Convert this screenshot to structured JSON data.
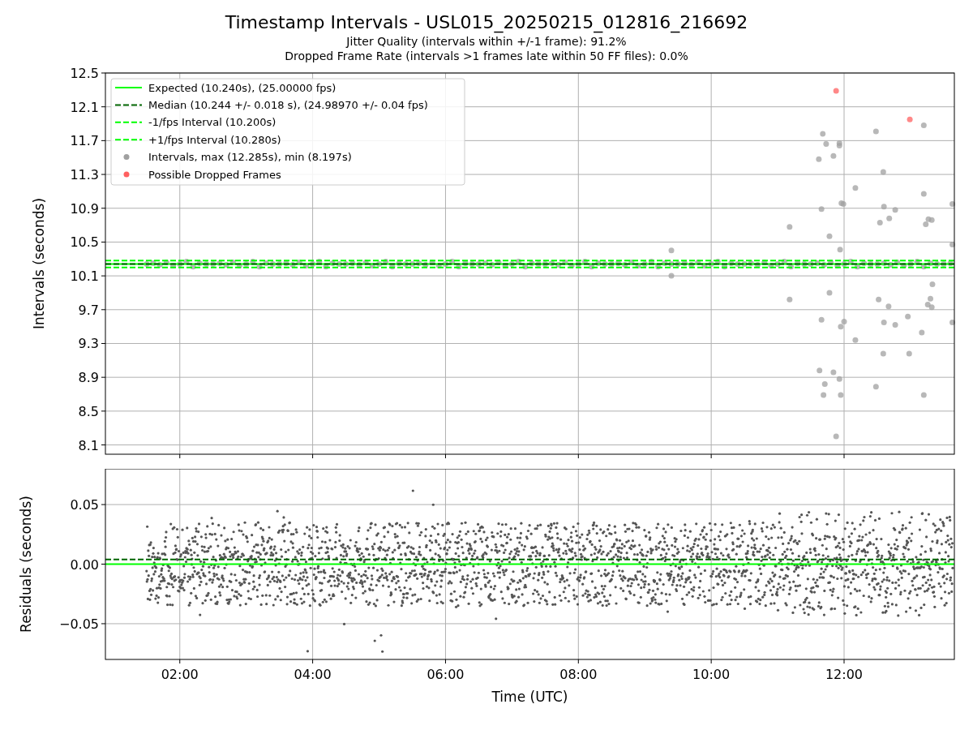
{
  "figure": {
    "title": "Timestamp Intervals - USL015_20250215_012816_216692",
    "subtitles": [
      "Jitter Quality (intervals within +/-1 frame): 91.2%",
      "Dropped Frame Rate (intervals >1 frames late within 50 FF files): 0.0%"
    ]
  },
  "intervals_panel": {
    "chart_data": {
      "type": "scatter",
      "ylabel": "Intervals (seconds)",
      "xlim": [
        0.88,
        13.66
      ],
      "ylim": [
        7.99,
        12.5
      ],
      "grid": true,
      "legend": "upper left",
      "yticks": [
        {
          "value": 8.1,
          "label": "8.1"
        },
        {
          "value": 8.5,
          "label": "8.5"
        },
        {
          "value": 8.9,
          "label": "8.9"
        },
        {
          "value": 9.3,
          "label": "9.3"
        },
        {
          "value": 9.7,
          "label": "9.7"
        },
        {
          "value": 10.1,
          "label": "10.1"
        },
        {
          "value": 10.5,
          "label": "10.5"
        },
        {
          "value": 10.9,
          "label": "10.9"
        },
        {
          "value": 11.3,
          "label": "11.3"
        },
        {
          "value": 11.7,
          "label": "11.7"
        },
        {
          "value": 12.1,
          "label": "12.1"
        },
        {
          "value": 12.5,
          "label": "12.5"
        }
      ],
      "ref_lines": [
        {
          "axis": "y",
          "value": 10.24,
          "label": "Expected (10.240s), (25.00000 fps)",
          "color": "#00ff00",
          "line_style": "solid"
        },
        {
          "axis": "y",
          "value": 10.24,
          "label": "Median (10.244 +/- 0.018 s), (24.98970 +/- 0.04 fps)",
          "color": "#006400",
          "line_style": "dashed"
        },
        {
          "axis": "y",
          "value": 10.2,
          "label": "-1/fps Interval (10.200s)",
          "color": "#00ff00",
          "line_style": "dashed"
        },
        {
          "axis": "y",
          "value": 10.28,
          "label": "+1/fps Interval (10.280s)",
          "color": "#00ff00",
          "line_style": "dashed"
        }
      ],
      "series": [
        {
          "name": "Intervals, max (12.285s), min (8.197s)",
          "color": "#a0a0a0",
          "x": [
            1.5,
            1.6,
            1.7,
            1.8,
            1.9,
            2.0,
            2.1,
            2.2,
            2.3,
            2.4,
            2.5,
            2.6,
            2.7,
            2.8,
            2.9,
            3.0,
            3.1,
            3.2,
            3.3,
            3.4,
            3.5,
            3.6,
            3.7,
            3.8,
            3.9,
            4.0,
            4.1,
            4.2,
            4.3,
            4.4,
            4.5,
            4.6,
            4.7,
            4.8,
            4.9,
            5.0,
            5.1,
            5.2,
            5.3,
            5.4,
            5.5,
            5.6,
            5.7,
            5.8,
            5.9,
            6.0,
            6.1,
            6.2,
            6.3,
            6.4,
            6.5,
            6.6,
            6.7,
            6.8,
            6.9,
            7.0,
            7.1,
            7.2,
            7.3,
            7.4,
            7.5,
            7.6,
            7.7,
            7.8,
            7.9,
            8.0,
            8.1,
            8.2,
            8.3,
            8.4,
            8.5,
            8.6,
            8.7,
            8.8,
            8.9,
            9.0,
            9.1,
            9.2,
            9.3,
            9.4,
            9.5,
            9.6,
            9.7,
            9.8,
            9.9,
            10.0,
            10.1,
            10.2,
            10.3,
            10.4,
            10.5,
            10.6,
            10.7,
            10.8,
            10.9,
            11.0,
            11.1,
            11.2,
            11.3,
            11.4,
            11.5,
            11.6,
            11.7,
            11.8,
            11.9,
            12.0,
            12.1,
            12.2,
            12.3,
            12.4,
            12.5,
            12.6,
            12.7,
            12.8,
            12.9,
            13.0,
            13.1,
            13.2,
            13.3,
            13.4,
            13.5,
            13.6,
            11.68,
            11.73,
            11.62,
            11.84,
            11.93,
            11.93,
            12.48,
            13.2,
            11.18,
            11.66,
            11.78,
            11.96,
            11.99,
            12.17,
            12.59,
            12.6,
            12.68,
            12.77,
            12.54,
            13.2,
            13.27,
            13.32,
            13.23,
            13.63,
            13.63,
            11.94,
            9.4,
            9.4,
            11.18,
            11.78,
            11.66,
            11.95,
            12.0,
            12.17,
            12.52,
            12.6,
            12.67,
            12.77,
            12.96,
            13.17,
            13.3,
            13.26,
            13.32,
            13.33,
            13.63,
            11.63,
            11.71,
            11.69,
            11.84,
            11.93,
            11.95,
            11.88,
            12.48,
            12.59,
            12.98,
            13.2
          ],
          "values": [
            10.24,
            10.25,
            10.23,
            10.26,
            10.22,
            10.24,
            10.27,
            10.21,
            10.25,
            10.24,
            10.24,
            10.25,
            10.23,
            10.26,
            10.22,
            10.24,
            10.27,
            10.21,
            10.25,
            10.24,
            10.24,
            10.25,
            10.23,
            10.26,
            10.22,
            10.24,
            10.27,
            10.21,
            10.25,
            10.24,
            10.24,
            10.25,
            10.23,
            10.26,
            10.22,
            10.24,
            10.27,
            10.21,
            10.25,
            10.24,
            10.24,
            10.25,
            10.23,
            10.26,
            10.22,
            10.24,
            10.27,
            10.21,
            10.25,
            10.24,
            10.24,
            10.25,
            10.23,
            10.26,
            10.22,
            10.24,
            10.27,
            10.21,
            10.25,
            10.24,
            10.24,
            10.25,
            10.23,
            10.26,
            10.22,
            10.24,
            10.27,
            10.21,
            10.25,
            10.24,
            10.24,
            10.25,
            10.23,
            10.26,
            10.22,
            10.24,
            10.27,
            10.21,
            10.25,
            10.24,
            10.24,
            10.25,
            10.23,
            10.26,
            10.22,
            10.24,
            10.27,
            10.21,
            10.25,
            10.24,
            10.24,
            10.25,
            10.23,
            10.26,
            10.22,
            10.24,
            10.27,
            10.21,
            10.25,
            10.24,
            10.24,
            10.25,
            10.23,
            10.26,
            10.22,
            10.24,
            10.27,
            10.21,
            10.25,
            10.24,
            10.24,
            10.25,
            10.23,
            10.26,
            10.22,
            10.24,
            10.27,
            10.21,
            10.25,
            10.24,
            10.24,
            10.25,
            11.78,
            11.66,
            11.48,
            11.52,
            11.64,
            11.67,
            11.81,
            11.88,
            10.68,
            10.89,
            10.57,
            10.96,
            10.95,
            11.14,
            11.33,
            10.92,
            10.78,
            10.88,
            10.73,
            11.07,
            10.77,
            10.76,
            10.71,
            10.95,
            10.47,
            10.41,
            10.4,
            10.1,
            9.82,
            9.9,
            9.58,
            9.5,
            9.56,
            9.34,
            9.82,
            9.55,
            9.74,
            9.52,
            9.62,
            9.43,
            9.83,
            9.76,
            9.73,
            10.0,
            9.55,
            8.98,
            8.82,
            8.69,
            8.96,
            8.88,
            8.69,
            8.2,
            8.79,
            9.18,
            9.18,
            8.69
          ]
        },
        {
          "name": "Possible Dropped Frames",
          "color": "#ff6060",
          "x": [
            11.88,
            12.99
          ],
          "values": [
            12.29,
            11.95
          ]
        }
      ]
    }
  },
  "residuals_panel": {
    "chart_data": {
      "type": "scatter",
      "xlabel": "Time (UTC)",
      "ylabel": "Residuals (seconds)",
      "xlim": [
        0.88,
        13.66
      ],
      "ylim": [
        -0.08,
        0.08
      ],
      "grid": true,
      "xticks": [
        {
          "value": 2,
          "label": "02:00"
        },
        {
          "value": 4,
          "label": "04:00"
        },
        {
          "value": 6,
          "label": "06:00"
        },
        {
          "value": 8,
          "label": "08:00"
        },
        {
          "value": 10,
          "label": "10:00"
        },
        {
          "value": 12,
          "label": "12:00"
        }
      ],
      "yticks": [
        {
          "value": -0.05,
          "label": "−0.05"
        },
        {
          "value": 0,
          "label": "0.00"
        },
        {
          "value": 0.05,
          "label": "0.05"
        }
      ],
      "ref_lines": [
        {
          "axis": "y",
          "value": 0,
          "color": "#00ff00",
          "line_style": "solid"
        },
        {
          "axis": "y",
          "value": 0.004,
          "color": "#006400",
          "line_style": "dashed"
        }
      ]
    }
  }
}
